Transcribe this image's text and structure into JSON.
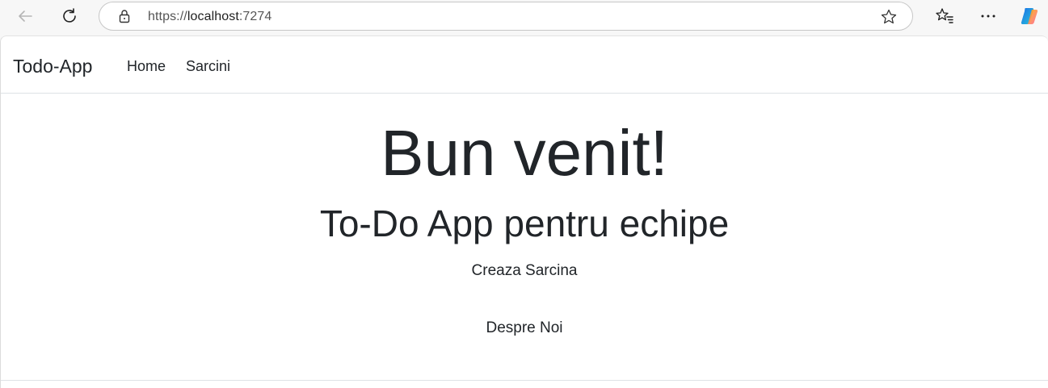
{
  "browser": {
    "url_scheme": "https://",
    "url_host": "localhost",
    "url_port": ":7274",
    "icons": [
      "back-arrow-icon",
      "refresh-icon",
      "lock-icon",
      "star-icon",
      "favorites-icon",
      "more-icon",
      "copilot-icon"
    ]
  },
  "navbar": {
    "brand": "Todo-App",
    "links": [
      "Home",
      "Sarcini"
    ]
  },
  "hero": {
    "title": "Bun venit!",
    "subtitle": "To-Do App pentru echipe",
    "create_link": "Creaza Sarcina",
    "about_link": "Despre Noi"
  }
}
